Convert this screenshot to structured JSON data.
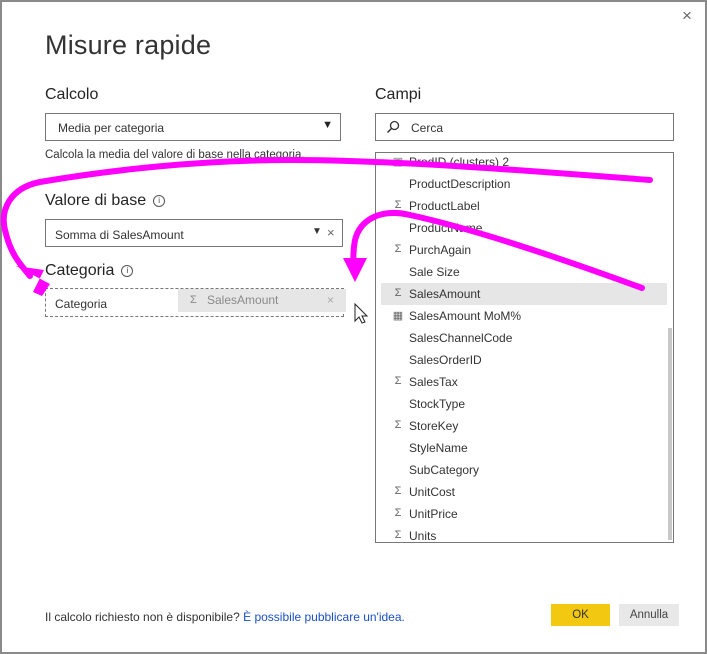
{
  "dialog": {
    "title": "Misure rapide",
    "close_glyph": "×"
  },
  "calc": {
    "heading": "Calcolo",
    "selected": "Media per categoria",
    "caret": "▼",
    "helper": "Calcola la media del valore di base nella categoria."
  },
  "base": {
    "heading": "Valore di base",
    "info": "i",
    "value": "Somma di SalesAmount",
    "caret": "▼",
    "clear": "×"
  },
  "category": {
    "heading": "Categoria",
    "info": "i",
    "placeholder": "Categoria",
    "drag_item": "SalesAmount",
    "drag_sigma": "Σ",
    "drag_clear": "×"
  },
  "fields": {
    "heading": "Campi",
    "search_placeholder": "Cerca",
    "items": [
      {
        "label": "ProdID (clusters) 2",
        "icon": "cluster-icon",
        "glyph": "▣"
      },
      {
        "label": "ProductDescription",
        "icon": "",
        "glyph": ""
      },
      {
        "label": "ProductLabel",
        "icon": "sigma-icon",
        "glyph": "Σ"
      },
      {
        "label": "ProductName",
        "icon": "",
        "glyph": ""
      },
      {
        "label": "PurchAgain",
        "icon": "sigma-icon",
        "glyph": "Σ"
      },
      {
        "label": "Sale Size",
        "icon": "",
        "glyph": ""
      },
      {
        "label": "SalesAmount",
        "icon": "sigma-icon",
        "glyph": "Σ",
        "selected": true
      },
      {
        "label": "SalesAmount MoM%",
        "icon": "calculator-icon",
        "glyph": "▦"
      },
      {
        "label": "SalesChannelCode",
        "icon": "",
        "glyph": ""
      },
      {
        "label": "SalesOrderID",
        "icon": "",
        "glyph": ""
      },
      {
        "label": "SalesTax",
        "icon": "sigma-icon",
        "glyph": "Σ"
      },
      {
        "label": "StockType",
        "icon": "",
        "glyph": ""
      },
      {
        "label": "StoreKey",
        "icon": "sigma-icon",
        "glyph": "Σ"
      },
      {
        "label": "StyleName",
        "icon": "",
        "glyph": ""
      },
      {
        "label": "SubCategory",
        "icon": "",
        "glyph": ""
      },
      {
        "label": "UnitCost",
        "icon": "sigma-icon",
        "glyph": "Σ"
      },
      {
        "label": "UnitPrice",
        "icon": "sigma-icon",
        "glyph": "Σ"
      },
      {
        "label": "Units",
        "icon": "sigma-icon",
        "glyph": "Σ"
      }
    ]
  },
  "footer": {
    "question": "Il calcolo richiesto non è disponibile? ",
    "link": "È possibile pubblicare un'idea."
  },
  "buttons": {
    "ok": "OK",
    "cancel": "Annulla"
  },
  "colors": {
    "annotation": "#ff00ff",
    "ok_button": "#f2c811",
    "link": "#1b4fc4"
  }
}
